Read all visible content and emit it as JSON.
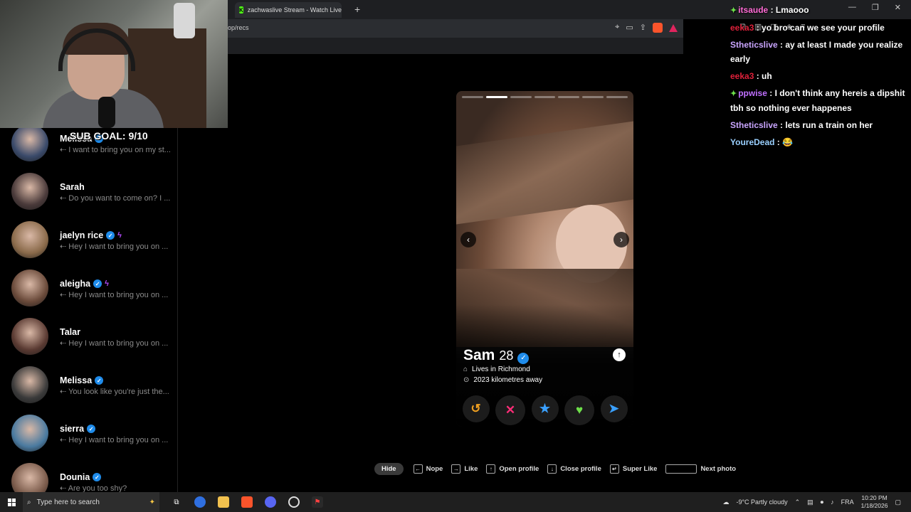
{
  "browser": {
    "tab_title": "zachwaslive Stream - Watch Live on K",
    "tab_close": "×",
    "new_tab": "+",
    "url": "op/recs"
  },
  "overlay": {
    "sub_goal": "SUB GOAL: 9/10"
  },
  "matches": [
    {
      "name": "Melissa",
      "message": "I want to bring you on my st...",
      "verified": true,
      "bolt": false,
      "avatar_color": "#3a4a6a"
    },
    {
      "name": "Sarah",
      "message": "Do you want to come on? I ...",
      "verified": false,
      "bolt": false,
      "avatar_color": "#4a3a3a"
    },
    {
      "name": "jaelyn rice",
      "message": "Hey I want to bring you on ...",
      "verified": true,
      "bolt": true,
      "avatar_color": "#8a6a4a"
    },
    {
      "name": "aleigha",
      "message": "Hey I want to bring you on ...",
      "verified": true,
      "bolt": true,
      "avatar_color": "#6a4a3a"
    },
    {
      "name": "Talar",
      "message": "Hey I want to bring you on ...",
      "verified": false,
      "bolt": false,
      "avatar_color": "#5a3a32"
    },
    {
      "name": "Melissa",
      "message": "You look like you're just the...",
      "verified": true,
      "bolt": false,
      "avatar_color": "#3a3a3a"
    },
    {
      "name": "sierra",
      "message": "Hey I want to bring you on ...",
      "verified": true,
      "bolt": false,
      "avatar_color": "#4a7aa0"
    },
    {
      "name": "Dounia",
      "message": "Are you too shy?",
      "verified": true,
      "bolt": false,
      "avatar_color": "#7a5a4a"
    }
  ],
  "profile": {
    "name": "Sam",
    "age": "28",
    "lives_in": "Lives in Richmond",
    "distance": "2023 kilometres away",
    "photo_count": 7,
    "active_photo": 2
  },
  "actions": {
    "rewind": "↺",
    "nope": "✕",
    "super_like": "★",
    "like": "♥",
    "boost": "➤"
  },
  "shortcuts": {
    "hide": "Hide",
    "nope": "Nope",
    "like": "Like",
    "open_profile": "Open profile",
    "close_profile": "Close profile",
    "super_like": "Super Like",
    "next_photo": "Next photo"
  },
  "chat": [
    {
      "badge": "✦",
      "user": "itsaude",
      "color": "#ff6bd5",
      "text": "Lmaooo"
    },
    {
      "badge": "",
      "user": "eeka3",
      "color": "#e0203a",
      "text": "yo bro can we see your profile"
    },
    {
      "badge": "",
      "user": "Stheticslive",
      "color": "#c9a5ff",
      "text": "ay at least I made you realize early"
    },
    {
      "badge": "",
      "user": "eeka3",
      "color": "#e0203a",
      "text": "uh"
    },
    {
      "badge": "✦",
      "user": "ppwise",
      "color": "#c070ff",
      "text": "I don't think any hereis a dipshit tbh so nothing ever happenes"
    },
    {
      "badge": "",
      "user": "Stheticslive",
      "color": "#c9a5ff",
      "text": "lets run a train on her"
    },
    {
      "badge": "",
      "user": "YoureDead",
      "color": "#9ad0ff",
      "text": "😂"
    }
  ],
  "taskbar": {
    "search_placeholder": "Type here to search",
    "weather": "-9°C  Partly cloudy",
    "lang": "FRA",
    "time": "10:20 PM",
    "date": "1/18/2026"
  },
  "colors": {
    "verified": "#1f8ceb",
    "nope": "#ff2d78",
    "rewind": "#f0a020",
    "super_like": "#3aa0ff",
    "like": "#6ee04a",
    "boost": "#3aa0ff"
  }
}
